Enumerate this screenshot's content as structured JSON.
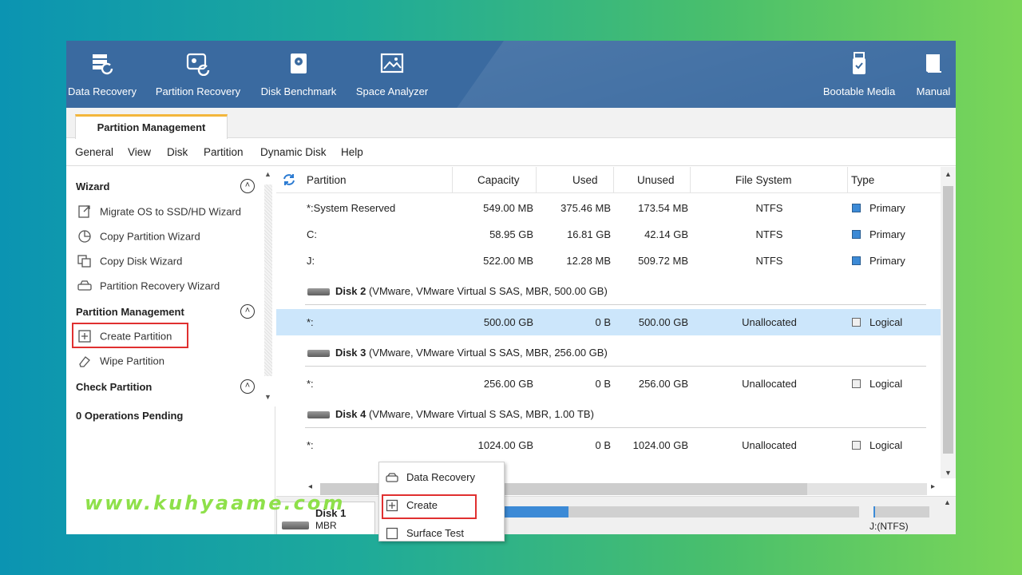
{
  "toolbar": {
    "data_recovery": "Data Recovery",
    "partition_recovery": "Partition Recovery",
    "disk_benchmark": "Disk Benchmark",
    "space_analyzer": "Space Analyzer",
    "bootable_media": "Bootable Media",
    "manual": "Manual"
  },
  "tab": {
    "label": "Partition Management"
  },
  "menu": {
    "general": "General",
    "view": "View",
    "disk": "Disk",
    "partition": "Partition",
    "dynamic_disk": "Dynamic Disk",
    "help": "Help"
  },
  "sidebar": {
    "wizard_title": "Wizard",
    "wizard_items": [
      "Migrate OS to SSD/HD Wizard",
      "Copy Partition Wizard",
      "Copy Disk Wizard",
      "Partition Recovery Wizard"
    ],
    "pm_title": "Partition Management",
    "pm_items": [
      "Create Partition",
      "Wipe Partition"
    ],
    "check_title": "Check Partition",
    "pending": "0 Operations Pending"
  },
  "table": {
    "headers": [
      "Partition",
      "Capacity",
      "Used",
      "Unused",
      "File System",
      "Type"
    ],
    "rows": [
      {
        "partition": "*:System Reserved",
        "capacity": "549.00 MB",
        "used": "375.46 MB",
        "unused": "173.54 MB",
        "fs": "NTFS",
        "type": "Primary"
      },
      {
        "partition": "C:",
        "capacity": "58.95 GB",
        "used": "16.81 GB",
        "unused": "42.14 GB",
        "fs": "NTFS",
        "type": "Primary"
      },
      {
        "partition": "J:",
        "capacity": "522.00 MB",
        "used": "12.28 MB",
        "unused": "509.72 MB",
        "fs": "NTFS",
        "type": "Primary"
      }
    ],
    "disks": [
      {
        "name": "Disk 2",
        "info": "(VMware, VMware Virtual S SAS, MBR, 500.00 GB)",
        "row": {
          "partition": "*:",
          "capacity": "500.00 GB",
          "used": "0 B",
          "unused": "500.00 GB",
          "fs": "Unallocated",
          "type": "Logical"
        }
      },
      {
        "name": "Disk 3",
        "info": "(VMware, VMware Virtual S SAS, MBR, 256.00 GB)",
        "row": {
          "partition": "*:",
          "capacity": "256.00 GB",
          "used": "0 B",
          "unused": "256.00 GB",
          "fs": "Unallocated",
          "type": "Logical"
        }
      },
      {
        "name": "Disk 4",
        "info": "(VMware, VMware Virtual S SAS, MBR, 1.00 TB)",
        "row": {
          "partition": "*:",
          "capacity": "1024.00 GB",
          "used": "0 B",
          "unused": "1024.00 GB",
          "fs": "Unallocated",
          "type": "Logical"
        }
      }
    ]
  },
  "diskmap": {
    "disk_name": "Disk 1",
    "disk_type": "MBR",
    "volume_label": "J:(NTFS)",
    "fill_fraction": 0.18
  },
  "context_menu": {
    "items": [
      "Data Recovery",
      "Create",
      "Surface Test"
    ]
  },
  "watermark": "www.kuhyaame.com",
  "colors": {
    "header_blue": "#3a6aa0",
    "tab_accent": "#f3b63c",
    "selected_row": "#cce6fb",
    "primary_square": "#3c8ad6",
    "highlight_red": "#e03030",
    "watermark": "#8ee04a"
  }
}
